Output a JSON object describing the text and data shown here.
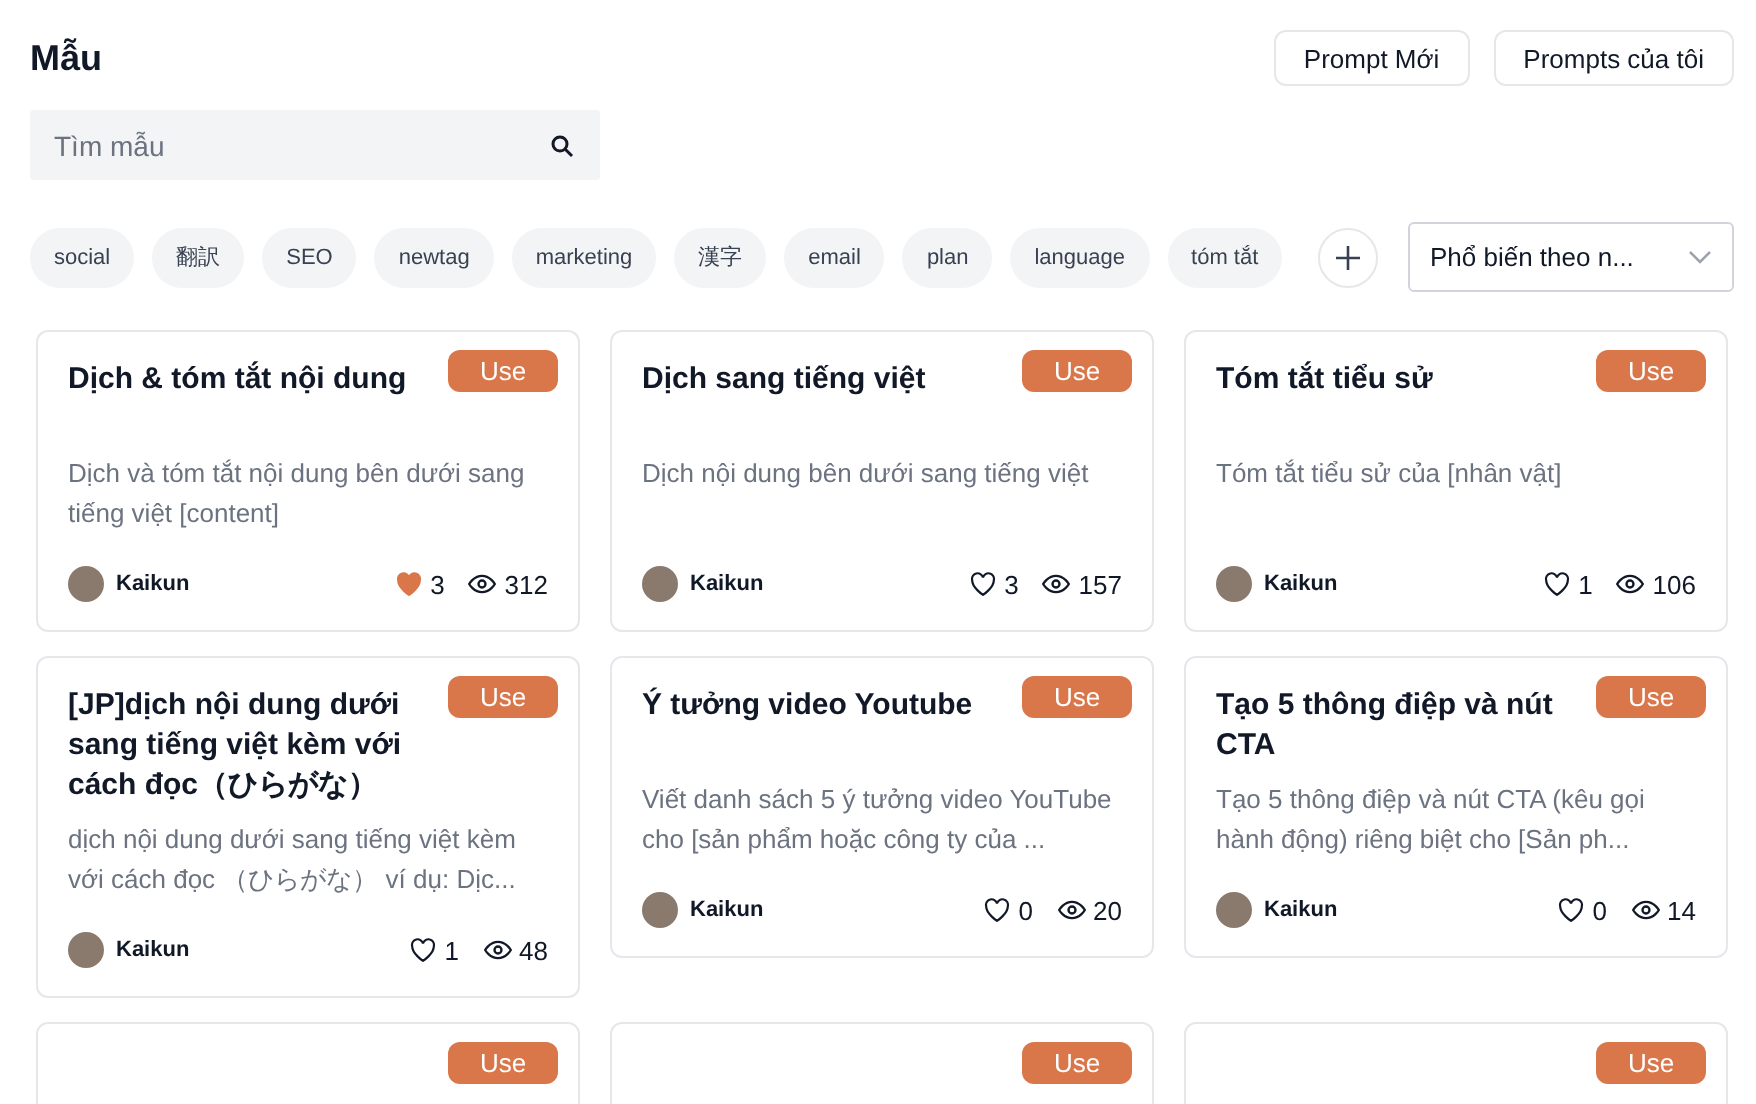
{
  "header": {
    "title": "Mẫu",
    "buttons": [
      "Prompt Mới",
      "Prompts của tôi"
    ]
  },
  "search": {
    "placeholder": "Tìm mẫu"
  },
  "tags": [
    "social",
    "翻訳",
    "SEO",
    "newtag",
    "marketing",
    "漢字",
    "email",
    "plan",
    "language",
    "tóm tắt"
  ],
  "sort": {
    "value": "Phổ biến theo n..."
  },
  "cards": [
    {
      "title": "Dịch & tóm tắt nội dung",
      "description": "Dịch và tóm tắt nội dung bên dưới sang tiếng việt [content]",
      "action": "Use",
      "author": "Kaikun",
      "liked": true,
      "likes": "3",
      "views": "312"
    },
    {
      "title": "Dịch sang tiếng việt",
      "description": "Dịch nội dung bên dưới sang tiếng việt",
      "action": "Use",
      "author": "Kaikun",
      "liked": false,
      "likes": "3",
      "views": "157"
    },
    {
      "title": "Tóm tắt tiểu sử",
      "description": "Tóm tắt tiểu sử của [nhân vật]",
      "action": "Use",
      "author": "Kaikun",
      "liked": false,
      "likes": "1",
      "views": "106"
    },
    {
      "title": "[JP]dịch nội dung dưới sang tiếng việt kèm với cách đọc（ひらがな）",
      "description": "dịch nội dung dưới sang tiếng việt kèm với cách đọc （ひらがな） ví dụ: Dịc...",
      "action": "Use",
      "author": "Kaikun",
      "liked": false,
      "likes": "1",
      "views": "48"
    },
    {
      "title": "Ý tưởng video Youtube",
      "description": "Viết danh sách 5 ý tưởng video YouTube cho [sản phẩm hoặc công ty của ...",
      "action": "Use",
      "author": "Kaikun",
      "liked": false,
      "likes": "0",
      "views": "20"
    },
    {
      "title": "Tạo 5 thông điệp và nút CTA",
      "description": "Tạo 5 thông điệp và nút CTA (kêu gọi hành động) riêng biệt cho [Sản ph...",
      "action": "Use",
      "author": "Kaikun",
      "liked": false,
      "likes": "0",
      "views": "14"
    },
    {
      "action": "Use"
    },
    {
      "action": "Use"
    },
    {
      "action": "Use"
    }
  ]
}
